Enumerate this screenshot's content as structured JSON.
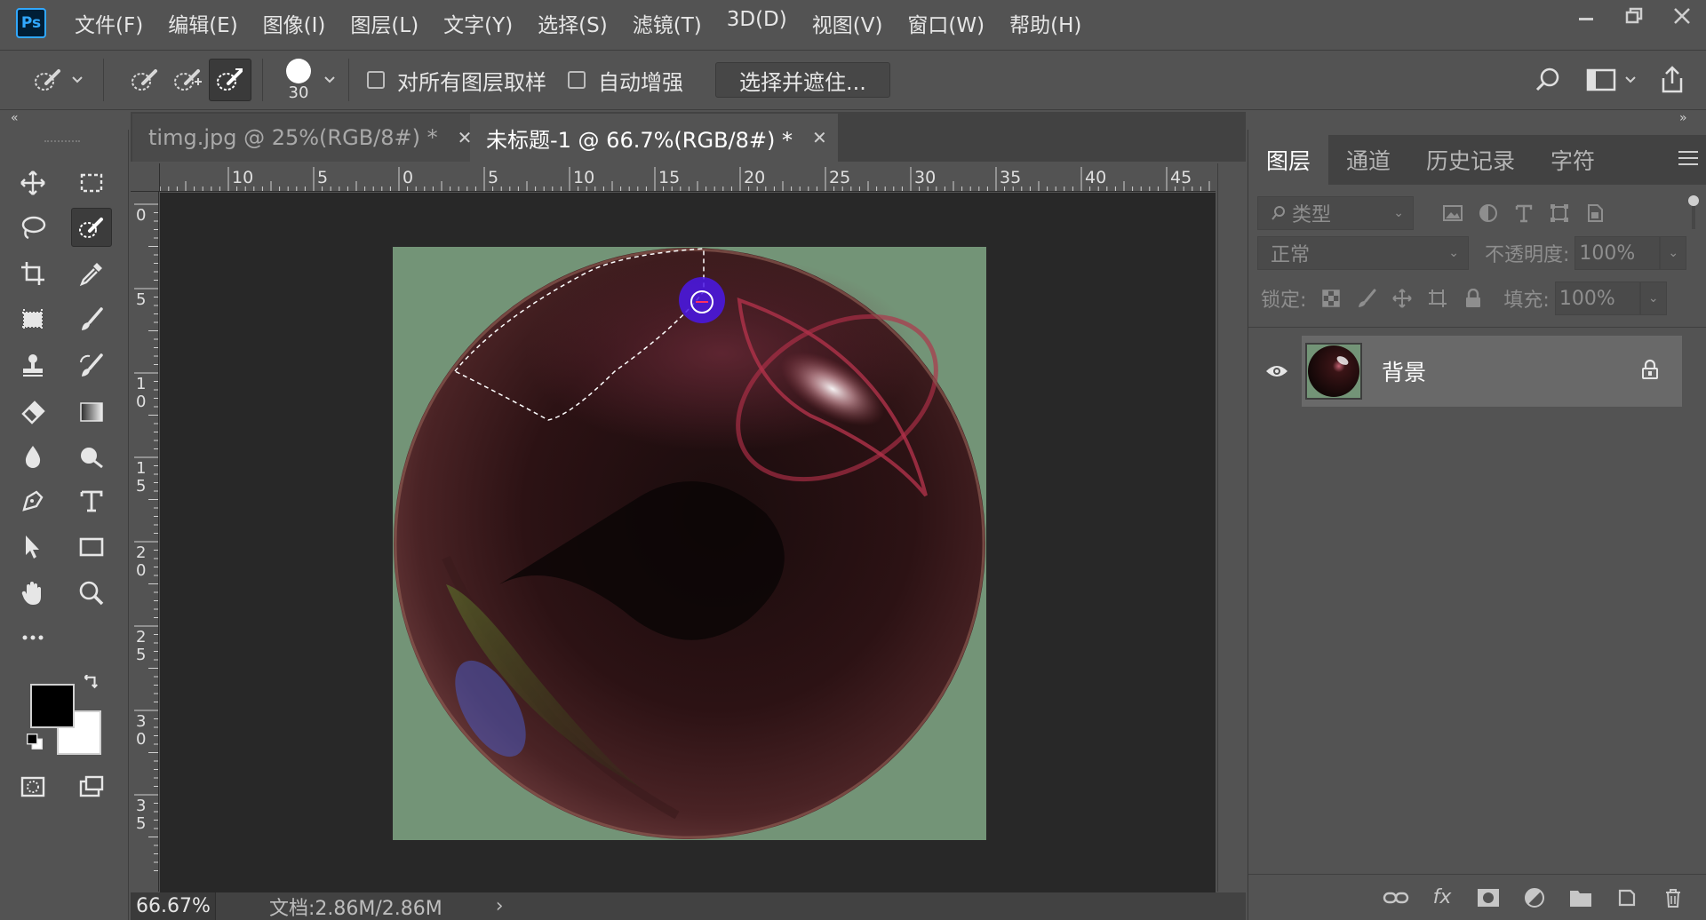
{
  "app": {
    "logo": "Ps"
  },
  "menu": [
    "文件(F)",
    "编辑(E)",
    "图像(I)",
    "图层(L)",
    "文字(Y)",
    "选择(S)",
    "滤镜(T)",
    "3D(D)",
    "视图(V)",
    "窗口(W)",
    "帮助(H)"
  ],
  "options": {
    "brush_size": "30",
    "sample_all_layers_label": "对所有图层取样",
    "sample_all_layers_checked": false,
    "auto_enhance_label": "自动增强",
    "auto_enhance_checked": false,
    "select_and_mask_label": "选择并遮住..."
  },
  "tabs": [
    {
      "label": "timg.jpg @ 25%(RGB/8#) *",
      "active": false
    },
    {
      "label": "未标题-1 @ 66.7%(RGB/8#) *",
      "active": true
    }
  ],
  "ruler_h_labels": [
    "10",
    "5",
    "0",
    "5",
    "10",
    "15",
    "20",
    "25",
    "30",
    "35",
    "40",
    "45"
  ],
  "ruler_v_labels": [
    "0",
    "5",
    "10",
    "15",
    "20",
    "25",
    "30",
    "35"
  ],
  "status": {
    "zoom": "66.67%",
    "doc_size": "文档:2.86M/2.86M",
    "arrow": "›"
  },
  "panel": {
    "tabs": [
      "图层",
      "通道",
      "历史记录",
      "字符"
    ],
    "filter_placeholder": "类型",
    "blend_mode": "正常",
    "opacity_label": "不透明度:",
    "opacity_value": "100%",
    "lock_label": "锁定:",
    "fill_label": "填充:",
    "fill_value": "100%",
    "layer": {
      "name": "背景",
      "visible": true,
      "locked": true
    }
  },
  "colors": {
    "foreground": "#000000",
    "background": "#ffffff",
    "canvas_bg": "#739477",
    "accent": "#31a8ff"
  }
}
